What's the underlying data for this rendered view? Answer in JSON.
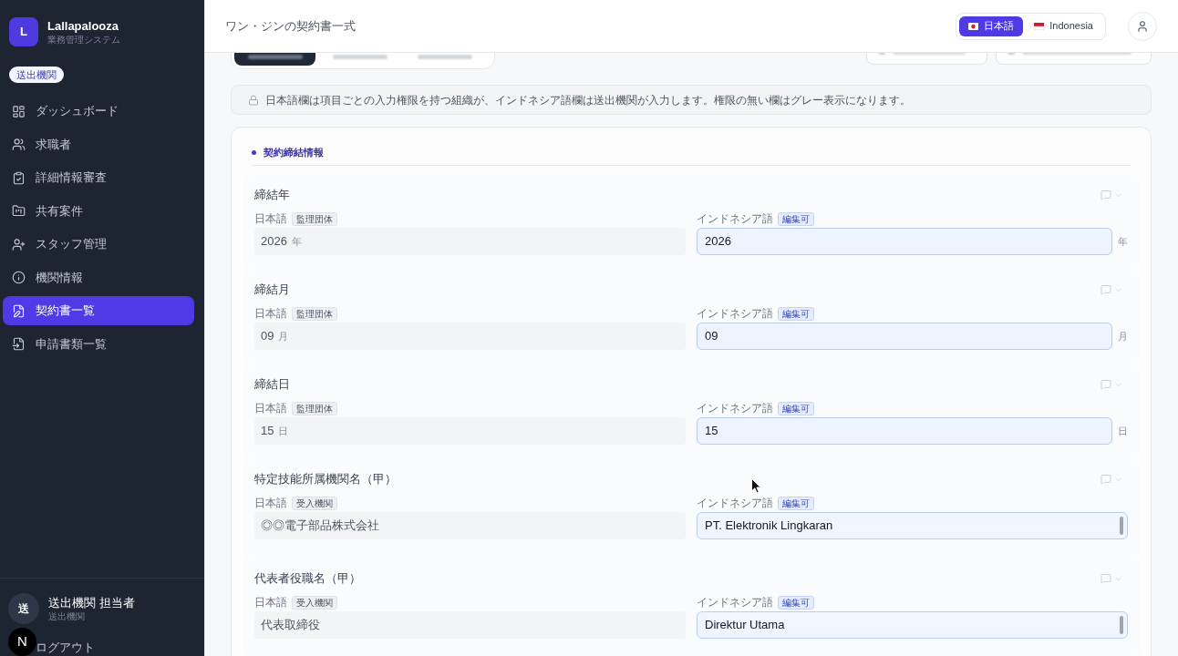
{
  "sidebar": {
    "logo": {
      "letter": "L",
      "name": "Lallapalooza",
      "subtitle": "業務管理システム"
    },
    "role_badge": "送出機関",
    "items": [
      {
        "label": "ダッシュボード",
        "selected": false
      },
      {
        "label": "求職者",
        "selected": false
      },
      {
        "label": "詳細情報審査",
        "selected": false
      },
      {
        "label": "共有案件",
        "selected": false
      },
      {
        "label": "スタッフ管理",
        "selected": false
      },
      {
        "label": "機関情報",
        "selected": false
      },
      {
        "label": "契約書一覧",
        "selected": true
      },
      {
        "label": "申請書類一覧",
        "selected": false
      }
    ],
    "user": {
      "avatar": "送",
      "name": "送出機関 担当者",
      "org": "送出機関"
    },
    "logout": "ログアウト",
    "dev_badge": "N"
  },
  "header": {
    "title": "ワン・ジンの契約書一式",
    "languages": [
      {
        "label": "日本語",
        "selected": true
      },
      {
        "label": "Indonesia",
        "selected": false
      }
    ]
  },
  "tabs": [
    {
      "selected": true
    },
    {
      "selected": false
    },
    {
      "selected": false
    }
  ],
  "notice": "日本語欄は項目ごとの入力権限を持つ組織が、インドネシア語欄は送出機関が入力します。権限の無い欄はグレー表示になります。",
  "section": {
    "title": "契約締結情報",
    "fields": [
      {
        "label": "締結年",
        "kind": "short",
        "japanese": {
          "language": "日本語",
          "org": "監理団体",
          "value": "2026",
          "unit": "年"
        },
        "indonesian": {
          "language": "インドネシア語",
          "badge": "編集可",
          "value": "2026",
          "unit": "年"
        }
      },
      {
        "label": "締結月",
        "kind": "short",
        "japanese": {
          "language": "日本語",
          "org": "監理団体",
          "value": "09",
          "unit": "月"
        },
        "indonesian": {
          "language": "インドネシア語",
          "badge": "編集可",
          "value": "09",
          "unit": "月"
        }
      },
      {
        "label": "締結日",
        "kind": "short",
        "japanese": {
          "language": "日本語",
          "org": "監理団体",
          "value": "15",
          "unit": "日"
        },
        "indonesian": {
          "language": "インドネシア語",
          "badge": "編集可",
          "value": "15",
          "unit": "日"
        }
      },
      {
        "label": "特定技能所属機関名（甲）",
        "kind": "long",
        "japanese": {
          "language": "日本語",
          "org": "受入機関",
          "value": "◎◎電子部品株式会社"
        },
        "indonesian": {
          "language": "インドネシア語",
          "badge": "編集可",
          "value": "PT. Elektronik Lingkaran"
        }
      },
      {
        "label": "代表者役職名（甲）",
        "kind": "long",
        "japanese": {
          "language": "日本語",
          "org": "受入機関",
          "value": "代表取締役"
        },
        "indonesian": {
          "language": "インドネシア語",
          "badge": "編集可",
          "value": "Direktur Utama"
        }
      }
    ]
  }
}
